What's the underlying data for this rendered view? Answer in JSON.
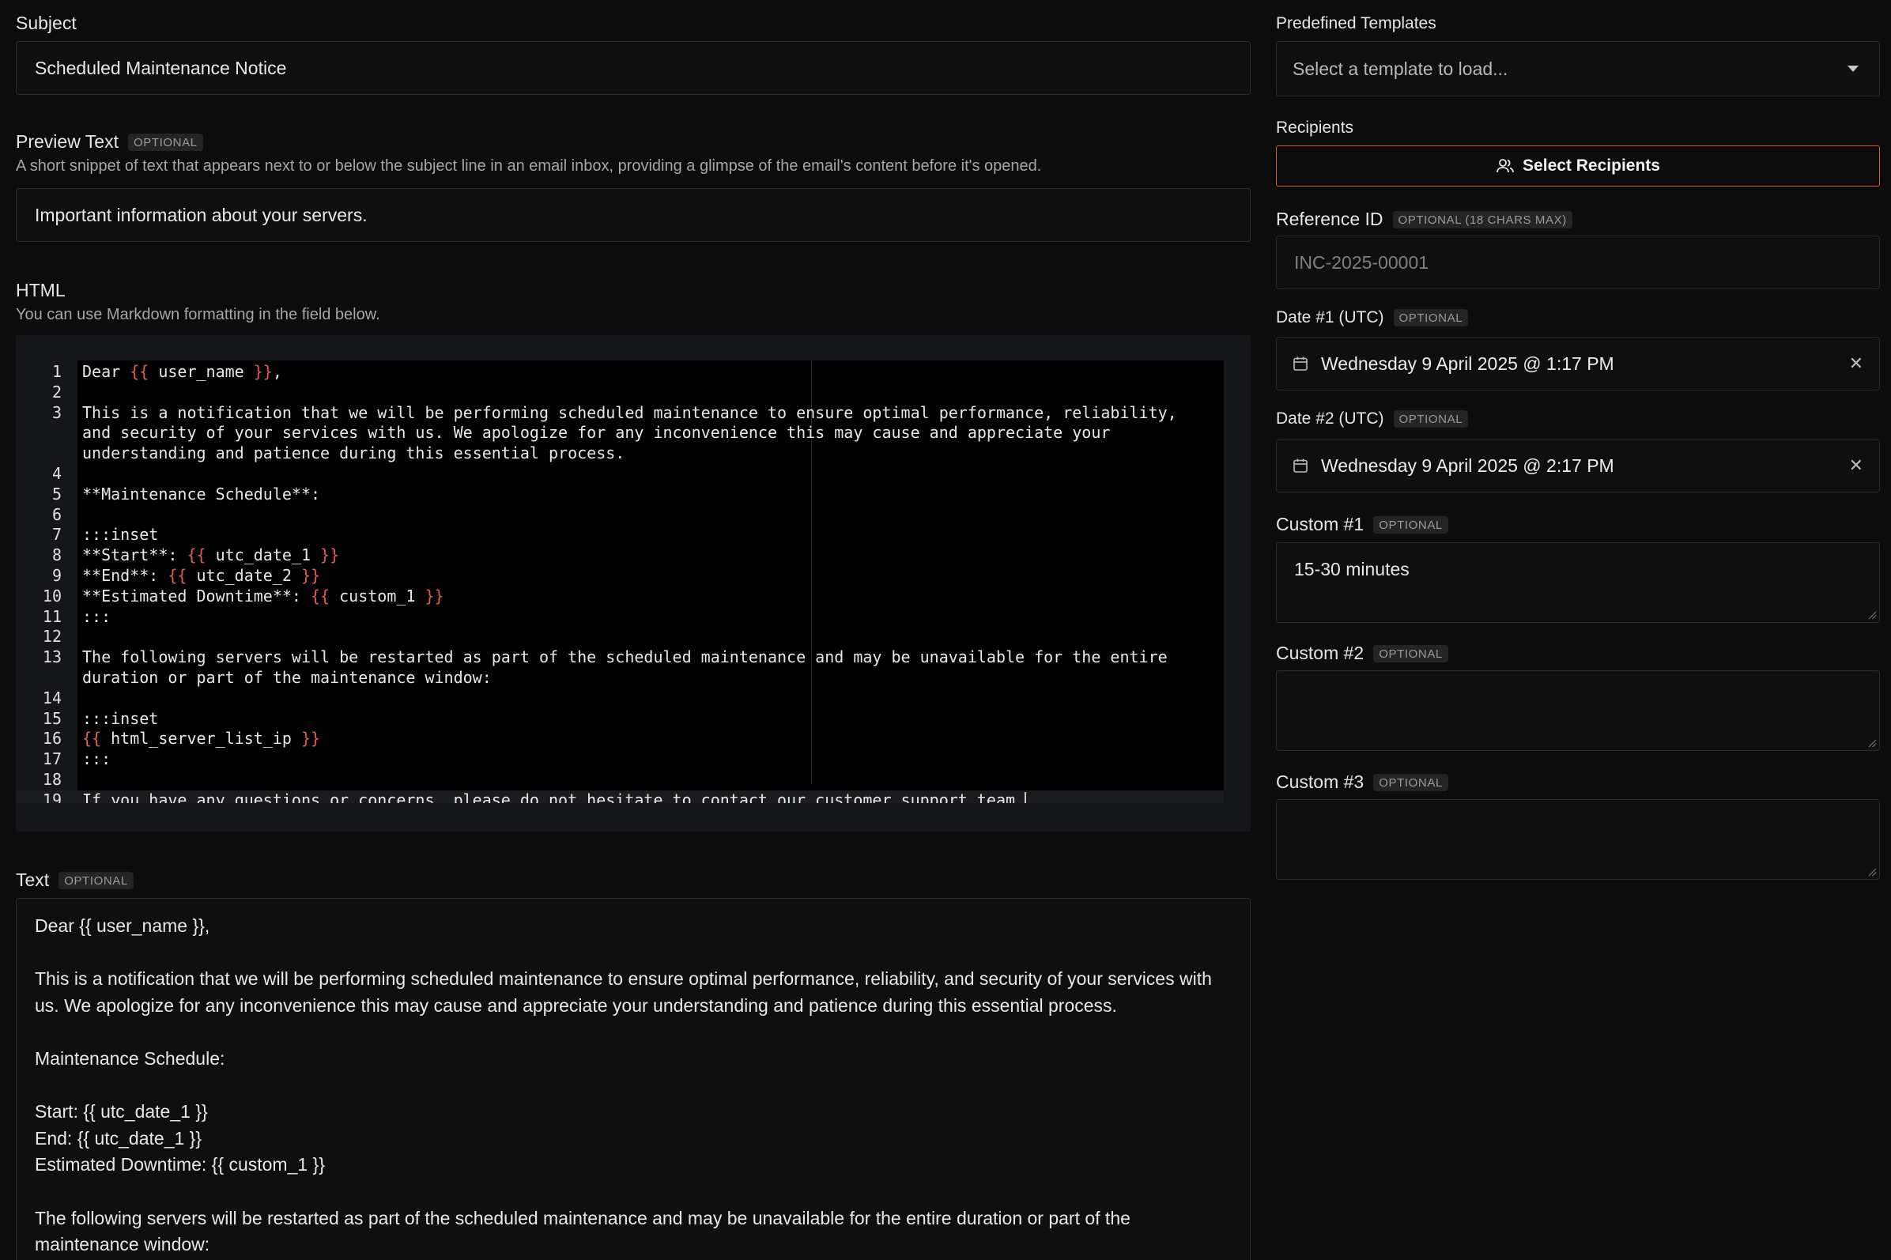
{
  "subject": {
    "label": "Subject",
    "value": "Scheduled Maintenance Notice"
  },
  "preview_text": {
    "label": "Preview Text",
    "badge": "OPTIONAL",
    "help": "A short snippet of text that appears next to or below the subject line in an email inbox, providing a glimpse of the email's content before it's opened.",
    "value": "Important information about your servers."
  },
  "html": {
    "label": "HTML",
    "help": "You can use Markdown formatting in the field below.",
    "lines": [
      {
        "n": "1",
        "segments": [
          {
            "t": "Dear "
          },
          {
            "t": "{{",
            "b": true
          },
          {
            "t": " user_name "
          },
          {
            "t": "}}",
            "b": true
          },
          {
            "t": ","
          }
        ]
      },
      {
        "n": "2",
        "segments": [
          {
            "t": ""
          }
        ]
      },
      {
        "n": "3",
        "segments": [
          {
            "t": "This is a notification that we will be performing scheduled maintenance to ensure optimal performance, reliability, and security of your services with us. We apologize for any inconvenience this may cause and appreciate your understanding and patience during this essential process."
          }
        ]
      },
      {
        "n": "4",
        "segments": [
          {
            "t": ""
          }
        ]
      },
      {
        "n": "5",
        "segments": [
          {
            "t": "**Maintenance Schedule**:"
          }
        ]
      },
      {
        "n": "6",
        "segments": [
          {
            "t": ""
          }
        ]
      },
      {
        "n": "7",
        "segments": [
          {
            "t": ":::inset"
          }
        ]
      },
      {
        "n": "8",
        "segments": [
          {
            "t": "**Start**: "
          },
          {
            "t": "{{",
            "b": true
          },
          {
            "t": " utc_date_1 "
          },
          {
            "t": "}}",
            "b": true
          }
        ]
      },
      {
        "n": "9",
        "segments": [
          {
            "t": "**End**: "
          },
          {
            "t": "{{",
            "b": true
          },
          {
            "t": " utc_date_2 "
          },
          {
            "t": "}}",
            "b": true
          }
        ]
      },
      {
        "n": "10",
        "segments": [
          {
            "t": "**Estimated Downtime**: "
          },
          {
            "t": "{{",
            "b": true
          },
          {
            "t": " custom_1 "
          },
          {
            "t": "}}",
            "b": true
          }
        ]
      },
      {
        "n": "11",
        "segments": [
          {
            "t": ":::"
          }
        ]
      },
      {
        "n": "12",
        "segments": [
          {
            "t": ""
          }
        ]
      },
      {
        "n": "13",
        "segments": [
          {
            "t": "The following servers will be restarted as part of the scheduled maintenance and may be unavailable for the entire duration or part of the maintenance window:"
          }
        ]
      },
      {
        "n": "14",
        "segments": [
          {
            "t": ""
          }
        ]
      },
      {
        "n": "15",
        "segments": [
          {
            "t": ":::inset"
          }
        ]
      },
      {
        "n": "16",
        "segments": [
          {
            "t": "{{",
            "b": true
          },
          {
            "t": " html_server_list_ip "
          },
          {
            "t": "}}",
            "b": true
          }
        ]
      },
      {
        "n": "17",
        "segments": [
          {
            "t": ":::"
          }
        ]
      },
      {
        "n": "18",
        "segments": [
          {
            "t": ""
          }
        ]
      },
      {
        "n": "19",
        "segments": [
          {
            "t": "If you have any questions or concerns, please do not hesitate to contact our customer support team."
          }
        ],
        "active": true
      }
    ]
  },
  "text": {
    "label": "Text",
    "badge": "OPTIONAL",
    "paragraphs": [
      "Dear {{ user_name }},",
      "",
      "This is a notification that we will be performing scheduled maintenance to ensure optimal performance, reliability, and security of your services with us. We apologize for any inconvenience this may cause and appreciate your understanding and patience during this essential process.",
      "",
      "Maintenance Schedule:",
      "",
      "Start: {{ utc_date_1 }}",
      "End: {{ utc_date_1 }}",
      "Estimated Downtime: {{ custom_1 }}",
      "",
      "The following servers will be restarted as part of the scheduled maintenance and may be unavailable for the entire duration or part of the maintenance window:"
    ]
  },
  "templates": {
    "label": "Predefined Templates",
    "placeholder": "Select a template to load..."
  },
  "recipients": {
    "label": "Recipients",
    "button": "Select Recipients"
  },
  "reference_id": {
    "label": "Reference ID",
    "badge": "OPTIONAL (18 CHARS MAX)",
    "placeholder": "INC-2025-00001"
  },
  "date1": {
    "label": "Date #1 (UTC)",
    "badge": "OPTIONAL",
    "value": "Wednesday 9 April 2025 @ 1:17 PM"
  },
  "date2": {
    "label": "Date #2 (UTC)",
    "badge": "OPTIONAL",
    "value": "Wednesday 9 April 2025 @ 2:17 PM"
  },
  "custom1": {
    "label": "Custom #1",
    "badge": "OPTIONAL",
    "value": "15-30 minutes"
  },
  "custom2": {
    "label": "Custom #2",
    "badge": "OPTIONAL",
    "value": ""
  },
  "custom3": {
    "label": "Custom #3",
    "badge": "OPTIONAL",
    "value": ""
  },
  "colors": {
    "accent": "#d6572e",
    "brace": "#e05a57",
    "background": "#0c0c0c"
  },
  "icons": {
    "calendar": "calendar-icon",
    "users": "users-icon",
    "clear": "close-icon",
    "dropdown": "chevron-down-icon"
  }
}
